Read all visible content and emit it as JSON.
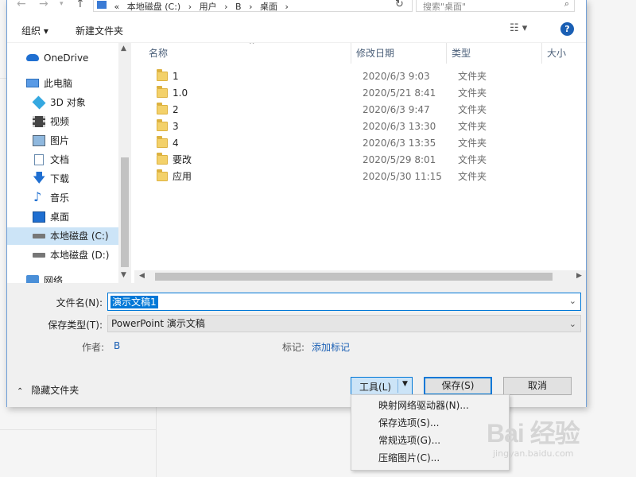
{
  "addressbar": {
    "path": [
      "本地磁盘 (C:)",
      "用户",
      "B",
      "桌面"
    ],
    "search_placeholder": "搜索\"桌面\""
  },
  "toolbar": {
    "organize_label": "组织 ▾",
    "new_folder_label": "新建文件夹",
    "help_label": "?"
  },
  "nav": {
    "items": [
      {
        "label": "OneDrive",
        "icon": "cloud-icon"
      },
      {
        "label": "此电脑",
        "icon": "computer-icon"
      },
      {
        "label": "3D 对象",
        "icon": "cube-icon"
      },
      {
        "label": "视频",
        "icon": "video-icon"
      },
      {
        "label": "图片",
        "icon": "picture-icon"
      },
      {
        "label": "文档",
        "icon": "document-icon"
      },
      {
        "label": "下载",
        "icon": "download-icon"
      },
      {
        "label": "音乐",
        "icon": "music-icon"
      },
      {
        "label": "桌面",
        "icon": "desktop-icon"
      },
      {
        "label": "本地磁盘 (C:)",
        "icon": "drive-icon",
        "selected": true
      },
      {
        "label": "本地磁盘 (D:)",
        "icon": "drive-icon"
      },
      {
        "label": "网络",
        "icon": "network-icon"
      }
    ]
  },
  "files": {
    "columns": [
      "名称",
      "修改日期",
      "类型",
      "大小"
    ],
    "rows": [
      {
        "name": "1",
        "date": "2020/6/3 9:03",
        "type": "文件夹"
      },
      {
        "name": "1.0",
        "date": "2020/5/21 8:41",
        "type": "文件夹"
      },
      {
        "name": "2",
        "date": "2020/6/3 9:47",
        "type": "文件夹"
      },
      {
        "name": "3",
        "date": "2020/6/3 13:30",
        "type": "文件夹"
      },
      {
        "name": "4",
        "date": "2020/6/3 13:35",
        "type": "文件夹"
      },
      {
        "name": "要改",
        "date": "2020/5/29 8:01",
        "type": "文件夹"
      },
      {
        "name": "应用",
        "date": "2020/5/30 11:15",
        "type": "文件夹"
      }
    ]
  },
  "form": {
    "filename_label": "文件名(N):",
    "filename_value": "演示文稿1",
    "filetype_label": "保存类型(T):",
    "filetype_value": "PowerPoint 演示文稿",
    "author_label": "作者:",
    "author_value": "B",
    "tags_label": "标记:",
    "tags_value": "添加标记"
  },
  "footer": {
    "hide_folders_label": "隐藏文件夹",
    "tools_label": "工具(L)",
    "save_label": "保存(S)",
    "cancel_label": "取消"
  },
  "tools_menu": {
    "items": [
      "映射网络驱动器(N)...",
      "保存选项(S)...",
      "常规选项(G)...",
      "压缩图片(C)..."
    ]
  },
  "watermark": {
    "logo": "Bai 经验",
    "url": "jingyan.baidu.com"
  },
  "colors": {
    "accent": "#0078d7",
    "selection": "#cce4f7",
    "folder": "#f3d16a",
    "link": "#1a5fb4"
  }
}
